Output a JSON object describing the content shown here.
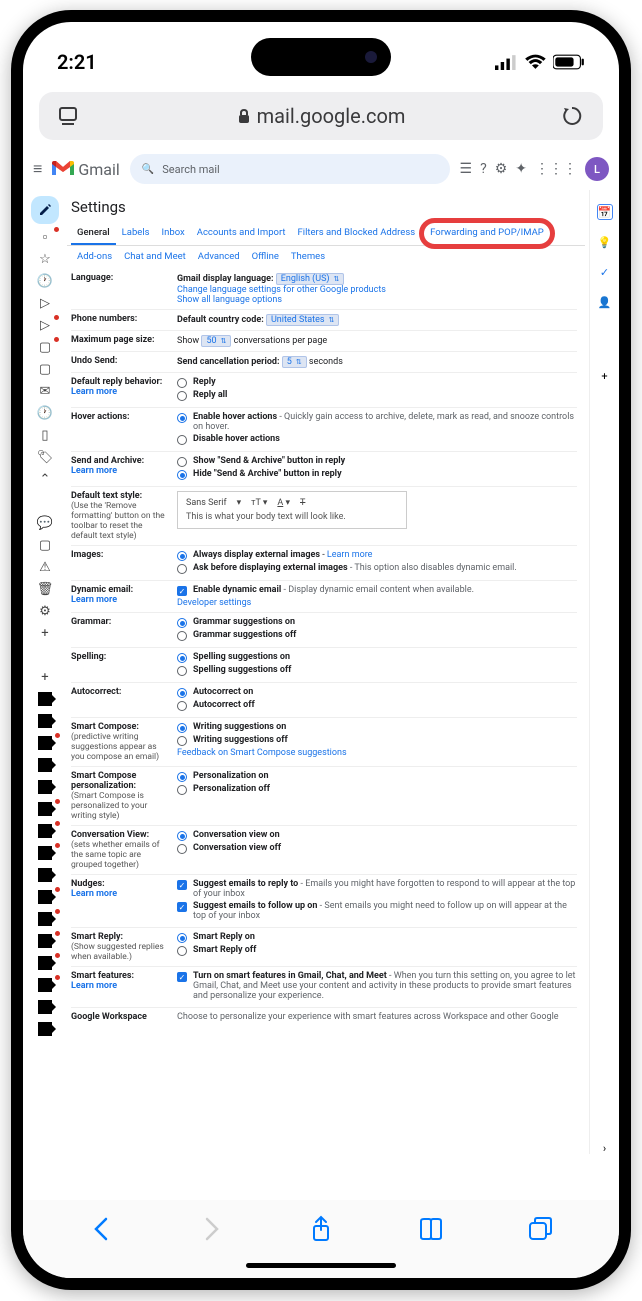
{
  "status": {
    "time": "2:21"
  },
  "safari": {
    "url": "mail.google.com"
  },
  "gmail": {
    "brand": "Gmail",
    "search_placeholder": "Search mail",
    "avatar_initial": "L"
  },
  "settings": {
    "title": "Settings",
    "tabs1": {
      "general": "General",
      "labels": "Labels",
      "inbox": "Inbox",
      "accounts": "Accounts and Import",
      "filters": "Filters and Blocked Address",
      "forwarding": "Forwarding and POP/IMAP"
    },
    "tabs2": {
      "addons": "Add-ons",
      "chat": "Chat and Meet",
      "advanced": "Advanced",
      "offline": "Offline",
      "themes": "Themes"
    },
    "language": {
      "label": "Language:",
      "display_label": "Gmail display language:",
      "value": "English (US)",
      "change_link": "Change language settings for other Google products",
      "show_all": "Show all language options"
    },
    "phone": {
      "label": "Phone numbers:",
      "country_label": "Default country code:",
      "value": "United States"
    },
    "pagesize": {
      "label": "Maximum page size:",
      "show": "Show",
      "value": "50",
      "suffix": "conversations per page"
    },
    "undo": {
      "label": "Undo Send:",
      "prefix": "Send cancellation period:",
      "value": "5",
      "suffix": "seconds"
    },
    "reply": {
      "label": "Default reply behavior:",
      "learn": "Learn more",
      "opt1": "Reply",
      "opt2": "Reply all"
    },
    "hover": {
      "label": "Hover actions:",
      "opt1": "Enable hover actions",
      "opt1_hint": " - Quickly gain access to archive, delete, mark as read, and snooze controls on hover.",
      "opt2": "Disable hover actions"
    },
    "sendarchive": {
      "label": "Send and Archive:",
      "learn": "Learn more",
      "opt1": "Show \"Send & Archive\" button in reply",
      "opt2": "Hide \"Send & Archive\" button in reply"
    },
    "textstyle": {
      "label": "Default text style:",
      "sub": "(Use the 'Remove formatting' button on the toolbar to reset the default text style)",
      "font": "Sans Serif",
      "sample": "This is what your body text will look like."
    },
    "images": {
      "label": "Images:",
      "opt1": "Always display external images",
      "learn": "Learn more",
      "opt2": "Ask before displaying external images",
      "opt2_hint": " - This option also disables dynamic email."
    },
    "dynamic": {
      "label": "Dynamic email:",
      "learn": "Learn more",
      "chk": "Enable dynamic email",
      "hint": " - Display dynamic email content when available.",
      "dev": "Developer settings"
    },
    "grammar": {
      "label": "Grammar:",
      "opt1": "Grammar suggestions on",
      "opt2": "Grammar suggestions off"
    },
    "spelling": {
      "label": "Spelling:",
      "opt1": "Spelling suggestions on",
      "opt2": "Spelling suggestions off"
    },
    "autocorrect": {
      "label": "Autocorrect:",
      "opt1": "Autocorrect on",
      "opt2": "Autocorrect off"
    },
    "smartcompose": {
      "label": "Smart Compose:",
      "sub": "(predictive writing suggestions appear as you compose an email)",
      "opt1": "Writing suggestions on",
      "opt2": "Writing suggestions off",
      "feedback": "Feedback on Smart Compose suggestions"
    },
    "smartpersonal": {
      "label": "Smart Compose personalization:",
      "sub": "(Smart Compose is personalized to your writing style)",
      "opt1": "Personalization on",
      "opt2": "Personalization off"
    },
    "convo": {
      "label": "Conversation View:",
      "sub": "(sets whether emails of the same topic are grouped together)",
      "opt1": "Conversation view on",
      "opt2": "Conversation view off"
    },
    "nudges": {
      "label": "Nudges:",
      "learn": "Learn more",
      "chk1": "Suggest emails to reply to",
      "hint1": " - Emails you might have forgotten to respond to will appear at the top of your inbox",
      "chk2": "Suggest emails to follow up on",
      "hint2": " - Sent emails you might need to follow up on will appear at the top of your inbox"
    },
    "smartreply": {
      "label": "Smart Reply:",
      "sub": "(Show suggested replies when available.)",
      "opt1": "Smart Reply on",
      "opt2": "Smart Reply off"
    },
    "smartfeatures": {
      "label": "Smart features:",
      "learn": "Learn more",
      "chk": "Turn on smart features in Gmail, Chat, and Meet",
      "hint": " - When you turn this setting on, you agree to let Gmail, Chat, and Meet use your content and activity in these products to provide smart features and personalize your experience."
    },
    "workspace": {
      "label": "Google Workspace",
      "text": "Choose to personalize your experience with smart features across Workspace and other Google"
    }
  }
}
